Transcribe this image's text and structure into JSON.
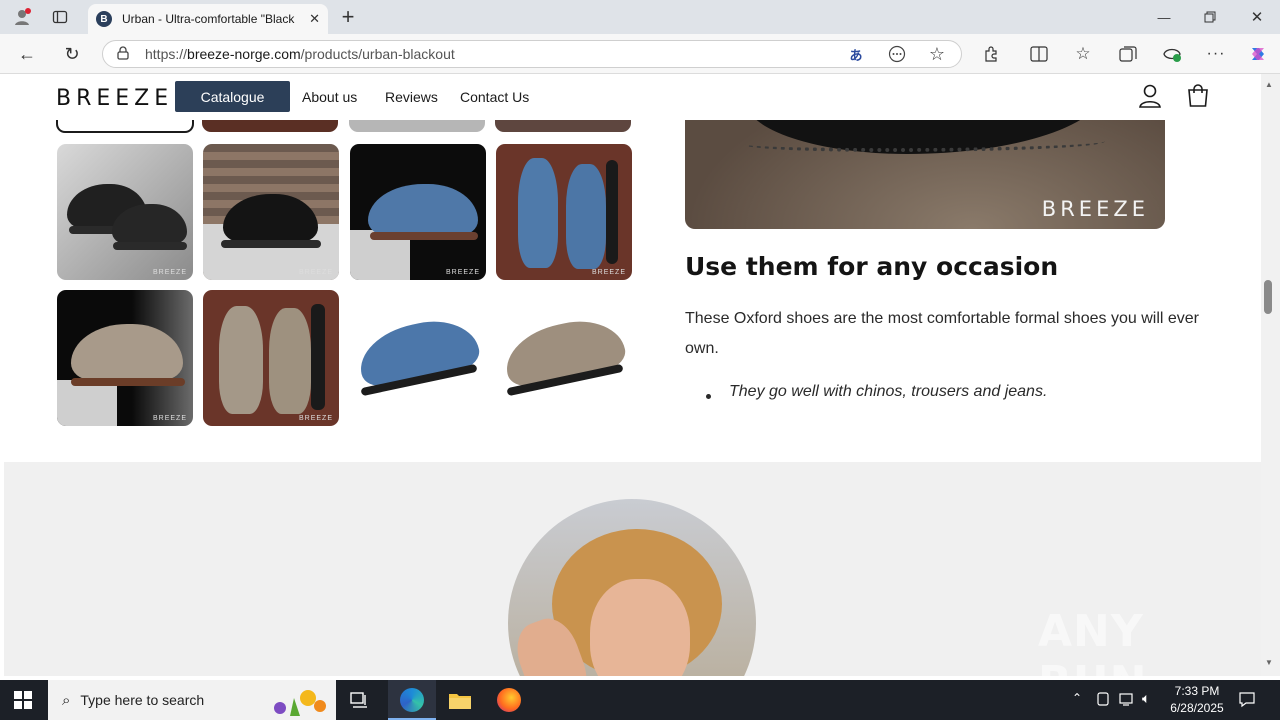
{
  "browser": {
    "tab_title": "Urban - Ultra-comfortable \"Black",
    "tab_favicon_letter": "B",
    "url_prefix": "https://",
    "url_domain": "breeze-norge.com",
    "url_path": "/products/urban-blackout"
  },
  "site": {
    "logo": "BREEZE",
    "nav": [
      "Catalogue",
      "About us",
      "Reviews",
      "Contact Us"
    ]
  },
  "product": {
    "hero_watermark": "BREEZE",
    "gallery_watermark": "BREEZE",
    "heading": "Use them for any occasion",
    "paragraph": "These Oxford shoes are the most comfortable formal shoes you will ever own.",
    "bullet": "They go well with chinos, trousers and jeans."
  },
  "overlay_watermark": "ANY RUN",
  "taskbar": {
    "search_placeholder": "Type here to search",
    "time": "7:33 PM",
    "date": "6/28/2025"
  },
  "colors": {
    "nav_active": "#2c3f58",
    "taskbar": "#1c2027"
  }
}
